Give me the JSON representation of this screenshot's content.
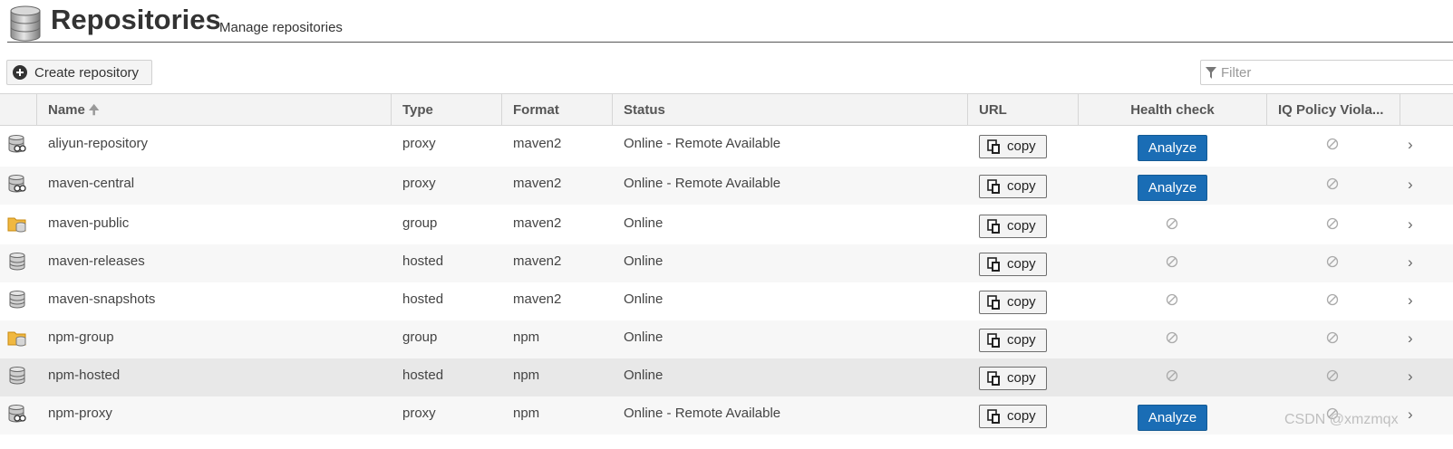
{
  "header": {
    "title": "Repositories",
    "subtitle": "Manage repositories"
  },
  "toolbar": {
    "create_label": "Create repository",
    "filter_placeholder": "Filter"
  },
  "columns": {
    "name": "Name",
    "type": "Type",
    "format": "Format",
    "status": "Status",
    "url": "URL",
    "health": "Health check",
    "iq": "IQ Policy Viola..."
  },
  "copy_label": "copy",
  "analyze_label": "Analyze",
  "rows": [
    {
      "name": "aliyun-repository",
      "type": "proxy",
      "format": "maven2",
      "status": "Online - Remote Available",
      "icon": "proxy-repository-icon",
      "health": "Analyze"
    },
    {
      "name": "maven-central",
      "type": "proxy",
      "format": "maven2",
      "status": "Online - Remote Available",
      "icon": "proxy-repository-icon",
      "health": "Analyze"
    },
    {
      "name": "maven-public",
      "type": "group",
      "format": "maven2",
      "status": "Online",
      "icon": "group-repository-icon",
      "health": "none"
    },
    {
      "name": "maven-releases",
      "type": "hosted",
      "format": "maven2",
      "status": "Online",
      "icon": "hosted-repository-icon",
      "health": "none"
    },
    {
      "name": "maven-snapshots",
      "type": "hosted",
      "format": "maven2",
      "status": "Online",
      "icon": "hosted-repository-icon",
      "health": "none"
    },
    {
      "name": "npm-group",
      "type": "group",
      "format": "npm",
      "status": "Online",
      "icon": "group-repository-icon",
      "health": "none"
    },
    {
      "name": "npm-hosted",
      "type": "hosted",
      "format": "npm",
      "status": "Online",
      "icon": "hosted-repository-icon",
      "health": "none"
    },
    {
      "name": "npm-proxy",
      "type": "proxy",
      "format": "npm",
      "status": "Online - Remote Available",
      "icon": "proxy-repository-icon",
      "health": "Analyze"
    }
  ],
  "watermark": "CSDN @xmzmqx",
  "colors": {
    "analyze_bg": "#1a6db5",
    "header_bg": "#f3f3f3",
    "row_alt": "#f7f7f7",
    "row_highlight": "#e8e8e8"
  }
}
